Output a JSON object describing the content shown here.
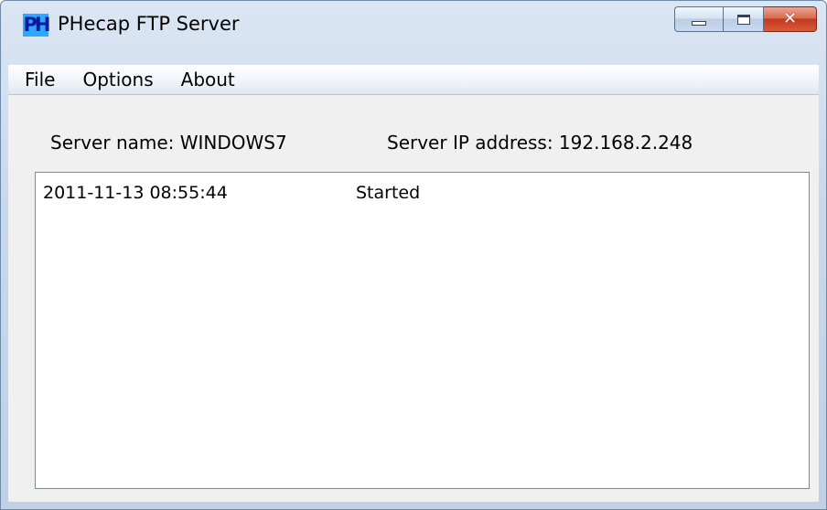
{
  "window": {
    "title": "PHecap FTP Server",
    "icon_text": "PH",
    "icon_name": "app-logo-icon",
    "buttons": {
      "minimize": "minimize-icon",
      "maximize": "maximize-icon",
      "close": "close-icon",
      "close_glyph": "✕"
    }
  },
  "menu": {
    "items": [
      {
        "label": "File"
      },
      {
        "label": "Options"
      },
      {
        "label": "About"
      }
    ]
  },
  "info": {
    "server_name": "Server name: WINDOWS7",
    "server_ip": "Server IP address: 192.168.2.248"
  },
  "log": {
    "entries": [
      {
        "time": "2011-11-13 08:55:44",
        "status": "Started"
      }
    ]
  },
  "colors": {
    "close_button": "#c4391d",
    "icon_background": "#2ea7ff",
    "log_border": "#828790"
  }
}
